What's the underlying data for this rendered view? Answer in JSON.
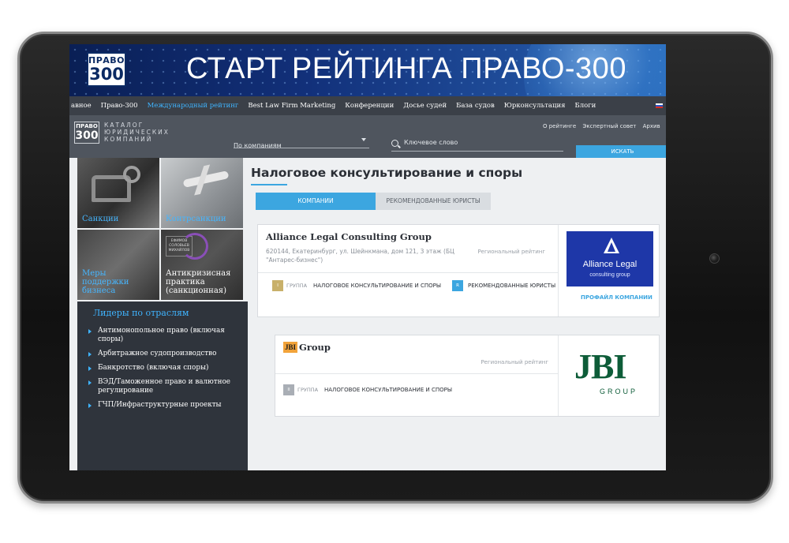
{
  "banner": {
    "logo_line1": "ПРАВО",
    "logo_line2": "300",
    "title": "СТАРТ РЕЙТИНГА ПРАВО-300"
  },
  "nav": {
    "items": [
      {
        "label": "авное"
      },
      {
        "label": "Право-300"
      },
      {
        "label": "Международный рейтинг"
      },
      {
        "label": "Best Law Firm Marketing"
      },
      {
        "label": "Конференции"
      },
      {
        "label": "Досье судей"
      },
      {
        "label": "База судов"
      },
      {
        "label": "Юрконсультация"
      },
      {
        "label": "Блоги"
      }
    ],
    "active_color": "#3fb4ff"
  },
  "catalog": {
    "logo_line1": "ПРАВО",
    "logo_line2": "300",
    "title": "КАТАЛОГ ЮРИДИЧЕСКИХ КОМПАНИЙ",
    "select_value": "По компаниям",
    "search_placeholder": "Ключевое слово",
    "links": [
      "О рейтинге",
      "Экспертный совет",
      "Архив"
    ],
    "search_button": "ИСКАТЬ"
  },
  "tiles": [
    {
      "label": "Санкции"
    },
    {
      "label": "Контрсанкции"
    },
    {
      "label": "Меры поддержки бизнеса"
    },
    {
      "label": "Антикризисная практика (санкционная)",
      "logo_text": "ЕФИМОВ СОЛОВЬЕВ МИХАЙЛОВ"
    }
  ],
  "leaders": {
    "title": "Лидеры по отраслям",
    "items": [
      "Антимонопольное право (включая споры)",
      "Арбитражное судопроизводство",
      "Банкротство (включая споры)",
      "ВЭД/Таможенное право и валютное регулирование",
      "ГЧП/Инфраструктурные проекты"
    ]
  },
  "main": {
    "page_title": "Налоговое консультирование и споры",
    "tabs": [
      {
        "label": "КОМПАНИИ",
        "active": true
      },
      {
        "label": "РЕКОМЕНДОВАННЫЕ ЮРИСТЫ",
        "active": false
      }
    ]
  },
  "cards": [
    {
      "name": "Alliance Legal Consulting Group",
      "address": "620144, Екатеринбург, ул. Шейнкмана, дом 121, 3 этаж (БЦ \"Антарес-бизнес\")",
      "rating": "Региональный рейтинг",
      "group_badge": "I",
      "group_label": "ГРУППА",
      "practice": "НАЛОГОВОЕ КОНСУЛЬТИРОВАНИЕ И СПОРЫ",
      "reco_badge": "R",
      "reco_label": "РЕКОМЕНДОВАННЫЕ ЮРИСТЫ",
      "logo_name": "Alliance Legal",
      "logo_sub": "consulting group",
      "profile_link": "ПРОФАЙЛ КОМПАНИИ",
      "badge_color": "#c8b06a",
      "logo_color": "#1e37a8"
    },
    {
      "mini_logo": "JBI",
      "name": "Group",
      "rating": "Региональный рейтинг",
      "group_badge": "II",
      "group_label": "ГРУППА",
      "practice": "НАЛОГОВОЕ КОНСУЛЬТИРОВАНИЕ И СПОРЫ",
      "logo_name": "JBI",
      "logo_sub": "GROUP",
      "badge_color": "#a9aeb5",
      "logo_color": "#0d5c38"
    }
  ]
}
